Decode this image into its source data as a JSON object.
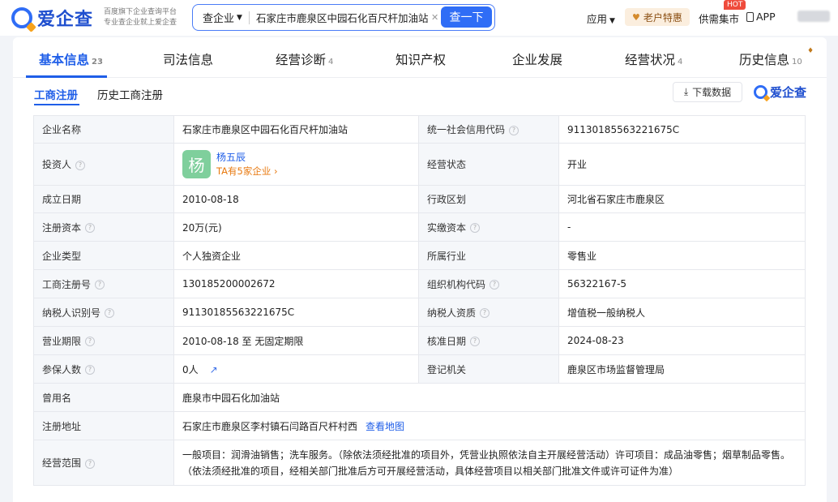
{
  "header": {
    "logo_text": "爱企查",
    "slogan_line1": "百度旗下企业查询平台",
    "slogan_line2": "专业查企业就上爱企查",
    "search_type": "查企业",
    "search_value": "石家庄市鹿泉区中园石化百尺杆加油站",
    "search_button": "查一下",
    "app_menu": "应用",
    "vip_label": "老户特惠",
    "supply_market": "供需集市",
    "hot_badge": "HOT",
    "app_download": "APP"
  },
  "tabs": [
    {
      "label": "基本信息",
      "count": "23"
    },
    {
      "label": "司法信息",
      "count": ""
    },
    {
      "label": "经营诊断",
      "count": "4"
    },
    {
      "label": "知识产权",
      "count": ""
    },
    {
      "label": "企业发展",
      "count": ""
    },
    {
      "label": "经营状况",
      "count": "4"
    },
    {
      "label": "历史信息",
      "count": "10"
    }
  ],
  "subtabs": {
    "registration": "工商注册",
    "history_registration": "历史工商注册",
    "download": "下载数据",
    "brand": "爱企查"
  },
  "info": {
    "company_name_label": "企业名称",
    "company_name": "石家庄市鹿泉区中园石化百尺杆加油站",
    "credit_code_label": "统一社会信用代码",
    "credit_code": "91130185563221675C",
    "investor_label": "投资人",
    "investor_avatar": "杨",
    "investor_name": "杨五辰",
    "investor_companies": "TA有5家企业",
    "status_label": "经营状态",
    "status": "开业",
    "founded_label": "成立日期",
    "founded": "2010-08-18",
    "region_label": "行政区划",
    "region": "河北省石家庄市鹿泉区",
    "capital_label": "注册资本",
    "capital": "20万(元)",
    "paid_capital_label": "实缴资本",
    "paid_capital": "-",
    "type_label": "企业类型",
    "type": "个人独资企业",
    "industry_label": "所属行业",
    "industry": "零售业",
    "reg_no_label": "工商注册号",
    "reg_no": "130185200002672",
    "org_code_label": "组织机构代码",
    "org_code": "56322167-5",
    "tax_id_label": "纳税人识别号",
    "tax_id": "91130185563221675C",
    "taxpayer_label": "纳税人资质",
    "taxpayer": "增值税一般纳税人",
    "term_label": "营业期限",
    "term": "2010-08-18 至 无固定期限",
    "approval_label": "核准日期",
    "approval": "2024-08-23",
    "insured_label": "参保人数",
    "insured": "0人",
    "authority_label": "登记机关",
    "authority": "鹿泉区市场监督管理局",
    "former_name_label": "曾用名",
    "former_name": "鹿泉市中园石化加油站",
    "address_label": "注册地址",
    "address": "石家庄市鹿泉区李村镇石闫路百尺杆村西",
    "map_link": "查看地图",
    "scope_label": "经营范围",
    "scope_line1": "一般项目：润滑油销售；洗车服务。（除依法须经批准的项目外，凭营业执照依法自主开展经营活动）许可项目：成品油零售；烟草制品零售。",
    "scope_line2": "（依法须经批准的项目，经相关部门批准后方可开展经营活动，具体经营项目以相关部门批准文件或许可证件为准）"
  }
}
